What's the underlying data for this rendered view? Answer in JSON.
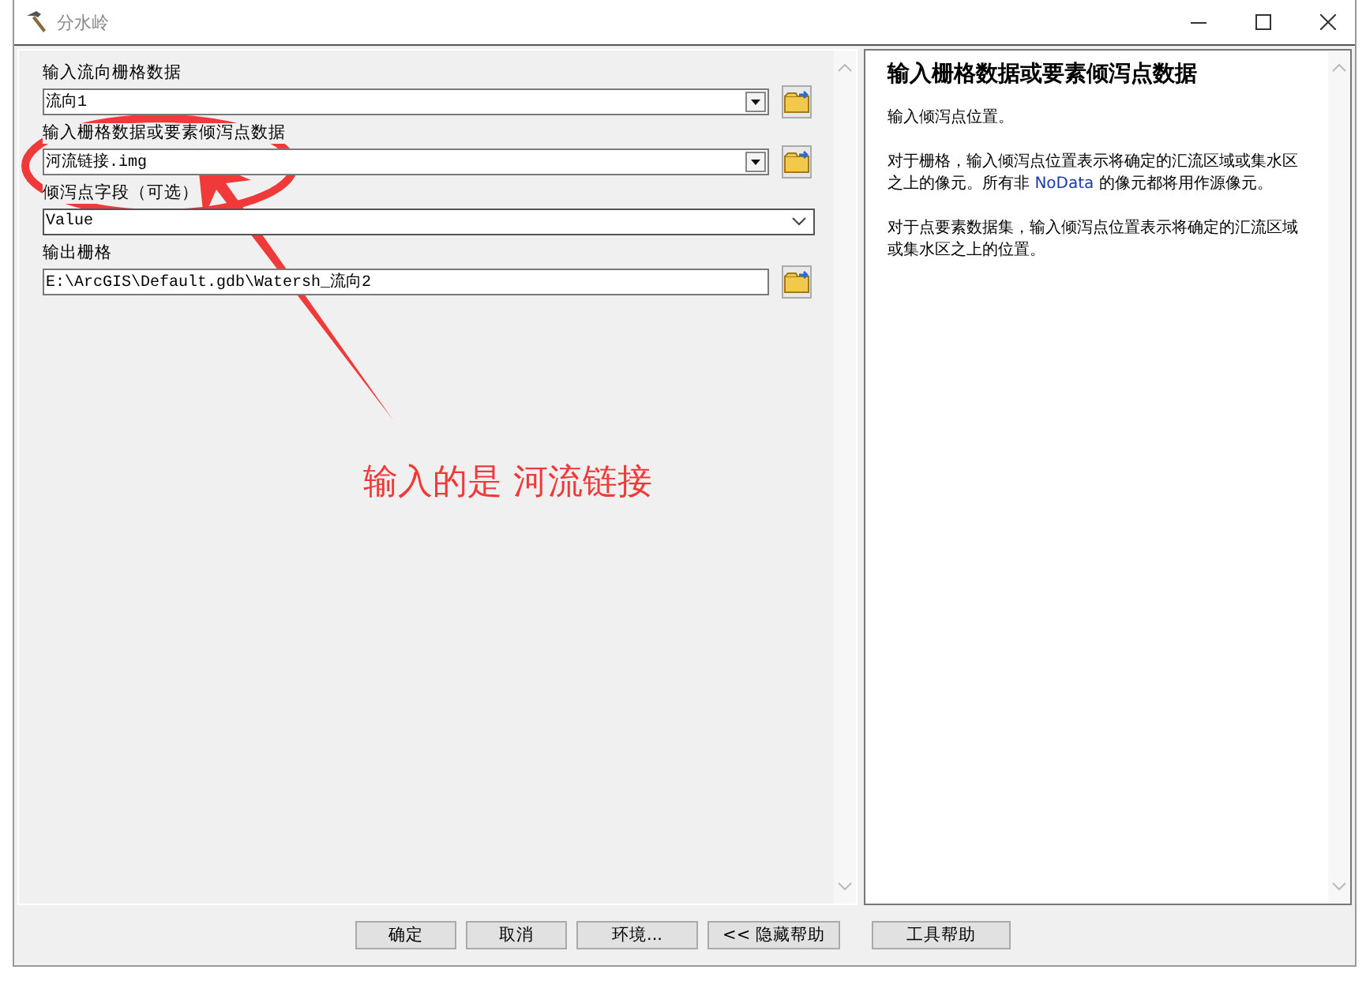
{
  "window": {
    "title": "分水岭"
  },
  "parameters": [
    {
      "label": "输入流向栅格数据",
      "kind": "combo",
      "value": "流向1"
    },
    {
      "label": "输入栅格数据或要素倾泻点数据",
      "kind": "combo",
      "value": "河流链接.img"
    },
    {
      "label": "倾泻点字段（可选）",
      "kind": "dropdown",
      "value": "Value"
    },
    {
      "label": "输出栅格",
      "kind": "text",
      "value": "E:\\ArcGIS\\Default.gdb\\Watersh_流向2"
    }
  ],
  "help": {
    "title": "输入栅格数据或要素倾泻点数据",
    "paragraphs": [
      [
        {
          "text": "输入倾泻点位置。",
          "highlight": false
        }
      ],
      [
        {
          "text": "对于栅格，输入倾泻点位置表示将确定的汇流区域或集水区之上的像元。所有非 ",
          "highlight": false
        },
        {
          "text": "NoData",
          "highlight": true
        },
        {
          "text": " 的像元都将用作源像元。",
          "highlight": false
        }
      ],
      [
        {
          "text": "对于点要素数据集，输入倾泻点位置表示将确定的汇流区域或集水区之上的位置。",
          "highlight": false
        }
      ]
    ]
  },
  "buttons": [
    "确定",
    "取消",
    "环境...",
    "<< 隐藏帮助",
    "工具帮助"
  ],
  "annotation": {
    "text": "输入的是 河流链接"
  }
}
